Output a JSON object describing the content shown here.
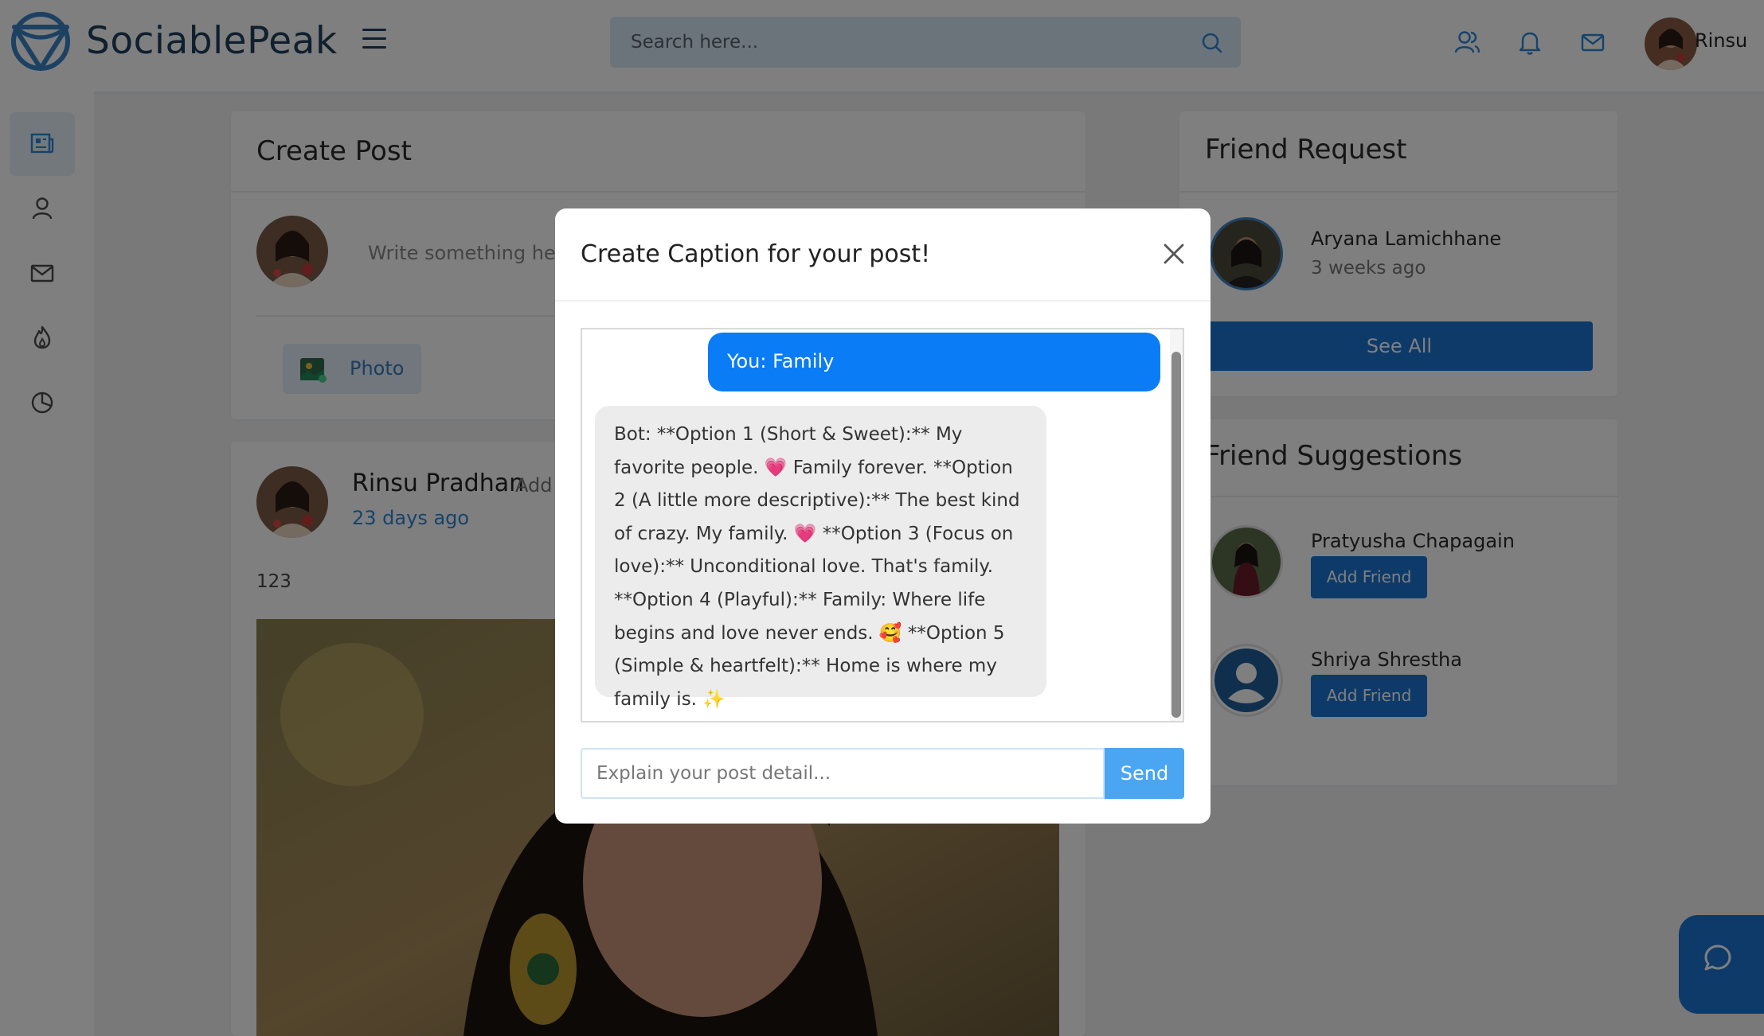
{
  "header": {
    "brand": "SociablePeak",
    "search_placeholder": "Search here...",
    "user_name": "Rinsu",
    "icons": [
      "logo-icon",
      "menu-icon",
      "search-icon",
      "friends-icon",
      "bell-icon",
      "mail-icon"
    ]
  },
  "sidebar": {
    "items": [
      {
        "name": "feed",
        "icon": "newspaper-icon",
        "active": true
      },
      {
        "name": "profile",
        "icon": "user-icon"
      },
      {
        "name": "messages",
        "icon": "mail-icon"
      },
      {
        "name": "trending",
        "icon": "flame-icon"
      },
      {
        "name": "analytics",
        "icon": "pie-chart-icon"
      }
    ]
  },
  "create_post": {
    "title": "Create Post",
    "placeholder": "Write something he",
    "photo_label": "Photo"
  },
  "post": {
    "author": "Rinsu Pradhan",
    "added": "Add",
    "time": "23 days ago",
    "text": "123"
  },
  "friend_request": {
    "title": "Friend Request",
    "name": "Aryana Lamichhane",
    "time": "3 weeks ago",
    "see_all": "See All"
  },
  "suggestions": {
    "title": "Friend Suggestions",
    "items": [
      {
        "name": "Pratyusha Chapagain",
        "button": "Add Friend"
      },
      {
        "name": "Shriya Shrestha",
        "button": "Add Friend"
      }
    ]
  },
  "modal": {
    "title": "Create Caption for your post!",
    "user_message": "You: Family",
    "bot_message": "Bot: **Option 1 (Short & Sweet):** My favorite people. 💗 Family forever. **Option 2 (A little more descriptive):** The best kind of crazy. My family. 💗 **Option 3 (Focus on love):** Unconditional love. That's family. **Option 4 (Playful):** Family: Where life begins and love never ends. 🥰 **Option 5 (Simple & heartfelt):** Home is where my family is. ✨",
    "input_placeholder": "Explain your post detail...",
    "send_label": "Send"
  },
  "colors": {
    "brand_dark": "#1f3f5c",
    "primary": "#1a74d2",
    "user_bubble": "#0a7cf6",
    "send": "#4aa6f3"
  }
}
